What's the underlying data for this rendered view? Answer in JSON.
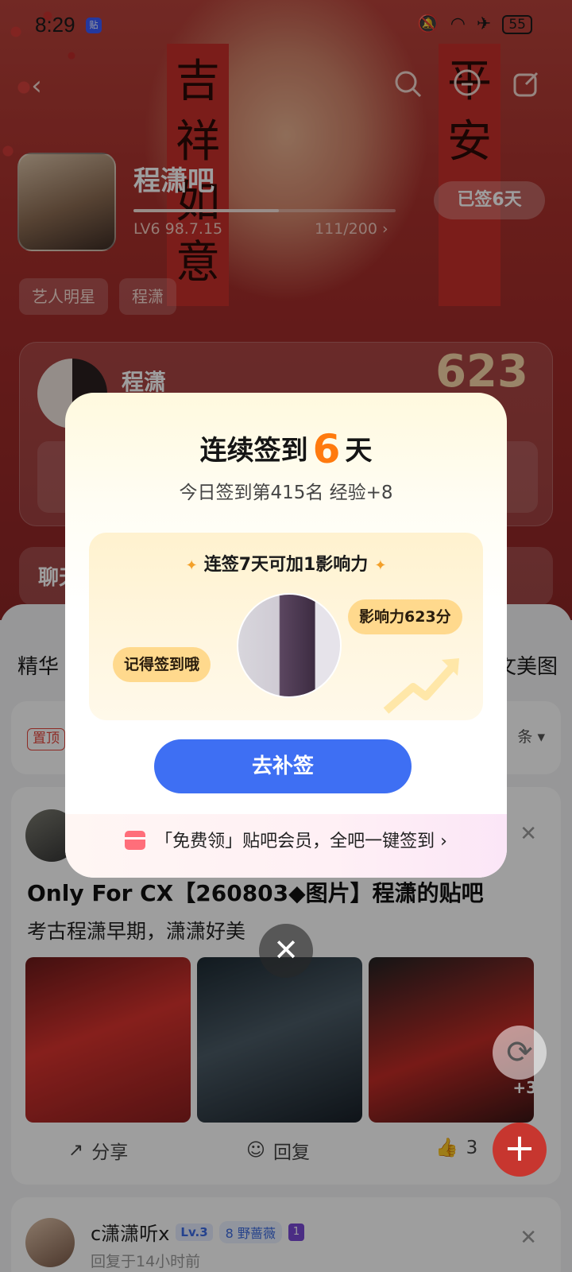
{
  "status_bar": {
    "time": "8:29",
    "app_badge": "贴",
    "battery": "55"
  },
  "header": {
    "couplet_left": "吉祥如意",
    "couplet_right": "平安",
    "forum_name": "程潇吧",
    "level": "LV6 98.7.15",
    "experience": "111/200 ›",
    "signed_label": "已签6天",
    "progress_fraction": 0.555
  },
  "tags": [
    "艺人明星",
    "程潇"
  ],
  "star_card": {
    "name": "程潇",
    "score": "623"
  },
  "chat_card": {
    "label": "聊天"
  },
  "content": {
    "tab_left": "精华",
    "tab_right": "美文美图",
    "pin_label": "置顶",
    "sort_label": "条 ▾"
  },
  "post": {
    "title": "Only For CX【260803◆图片】程潇的贴吧",
    "desc": "考古程潇早期，潇潇好美",
    "more_photos": "+3",
    "share_label": "分享",
    "reply_label": "回复",
    "like_count": "3"
  },
  "post2": {
    "username": "c潇潇听x",
    "level_badge": "Lv.3",
    "fan_level": "8",
    "fan_group": "野蔷薇",
    "rank": "1",
    "time": "回复于14小时前"
  },
  "modal": {
    "title_prefix": "连续签到",
    "title_days": "6",
    "title_suffix": "天",
    "subtitle": "今日签到第415名 经验+8",
    "reward_title": "连签7天可加1影响力",
    "bubble_left": "记得签到哦",
    "bubble_right": "影响力623分",
    "button": "去补签",
    "promo": "「免费领」贴吧会员，全吧一键签到 ›"
  },
  "icons": {
    "back": "chevron-left-icon",
    "search": "search-icon",
    "message": "message-icon",
    "share": "share-icon",
    "close": "close-icon",
    "refresh": "refresh-icon",
    "add": "plus-icon"
  },
  "colors": {
    "accent_orange": "#ff7a0e",
    "button_blue": "#3e6ff3",
    "fab_red": "#c7362f"
  }
}
